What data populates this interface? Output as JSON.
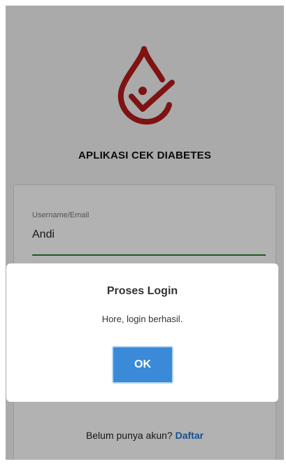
{
  "app": {
    "title": "APLIKASI CEK DIABETES",
    "logo_icon": "blood-drop-check-icon",
    "brand_color": "#b71c1c"
  },
  "login_form": {
    "username_label": "Username/Email",
    "username_value": "Andi",
    "signup_prompt": "Belum punya akun?",
    "signup_link": "Daftar",
    "underline_color": "#2e7d32"
  },
  "dialog": {
    "title": "Proses Login",
    "message": "Hore, login berhasil.",
    "ok_label": "OK",
    "button_color": "#3a8ad8"
  }
}
